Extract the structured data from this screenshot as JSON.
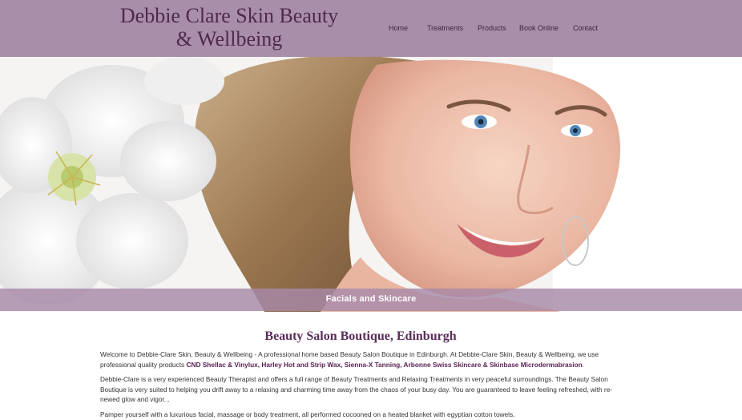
{
  "header": {
    "site_title": "Debbie Clare Skin Beauty & Wellbeing",
    "nav": [
      {
        "label": "Home"
      },
      {
        "label": "Treatments"
      },
      {
        "label": "Products"
      },
      {
        "label": "Book Online"
      },
      {
        "label": "Contact"
      }
    ]
  },
  "hero": {
    "caption": "Facials and Skincare"
  },
  "main": {
    "heading": "Beauty Salon Boutique, Edinburgh",
    "paragraphs": [
      {
        "text_before": "Welcome to Debbie-Clare Skin, Beauty & Wellbeing - A professional home based Beauty Salon Boutique in Edinburgh. At Debbie-Clare Skin, Beauty & Wellbeing, we use professional quality products ",
        "highlight": "CND Shellac & Vinylux, Harley Hot and Strip Wax, Sienna-X Tanning, Arbonne Swiss Skincare & Skinbase Microdermabrasion",
        "text_after": "."
      },
      {
        "text": "Debbie-Clare is a very experienced Beauty Therapist and offers a full range of Beauty Treatments and Relaxing Treatments in very peaceful surroundings. The Beauty Salon Boutique is very suited to helping you drift away to a relaxing and charming time away from the chaos of your busy day. You are guaranteed to leave feeling refreshed, with re-newed glow and vigor..."
      },
      {
        "text": "Pamper yourself with a luxurious facial, massage or body treatment, all performed cocooned on a heated blanket with egyptian cotton towels."
      }
    ]
  },
  "colors": {
    "header_bg": "#a98ea9",
    "title": "#4e2a4e",
    "heading": "#5a2d5a",
    "highlight_text": "#5a2255"
  }
}
